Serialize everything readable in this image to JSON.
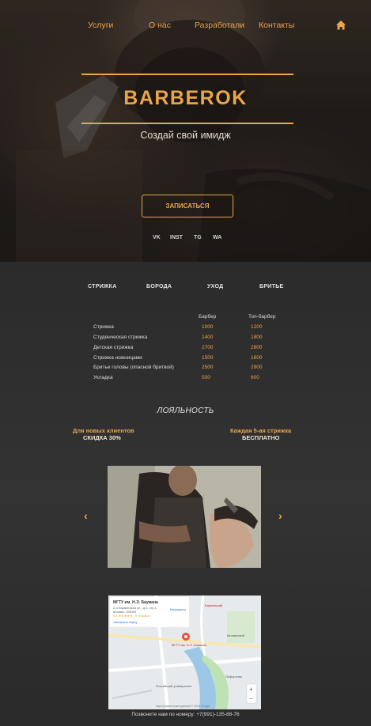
{
  "nav": {
    "items": [
      "Услуги",
      "О нас",
      "Разработали",
      "Контакты"
    ],
    "home_icon": "home-icon"
  },
  "hero": {
    "brand": "BARBEROK",
    "tagline": "Создай свой имидж",
    "cta_label": "ЗАПИСАТЬСЯ",
    "social": [
      "VK",
      "INST",
      "TG",
      "WA"
    ]
  },
  "services": {
    "tabs": [
      "СТРИЖКА",
      "БОРОДА",
      "УХОД",
      "БРИТЬЕ"
    ],
    "columns": [
      "Барбер",
      "Топ-барбер"
    ],
    "rows": [
      {
        "name": "Стрижка",
        "barber": "1000",
        "top": "1200"
      },
      {
        "name": "Студенческая стрижка",
        "barber": "1400",
        "top": "1800"
      },
      {
        "name": "Детская стрижка",
        "barber": "2700",
        "top": "2800"
      },
      {
        "name": "Стрижка ножницами",
        "barber": "1500",
        "top": "1600"
      },
      {
        "name": "Бритье головы (опасной бритвой)",
        "barber": "2500",
        "top": "2900"
      },
      {
        "name": "Укладка",
        "barber": "500",
        "top": "600"
      }
    ]
  },
  "loyalty": {
    "title": "ЛОЯЛЬНОСТЬ",
    "left_line1": "Для новых клиентов",
    "left_line2": "СКИДКА 30%",
    "right_line1": "Каждая 5-ая стрижка",
    "right_line2": "БЕСПЛАТНО"
  },
  "carousel": {
    "prev": "‹",
    "next": "›"
  },
  "map": {
    "card_title": "МГТУ им. Н.Э. Баумана",
    "card_addr": "2-я Бауманская ул., д.5, стр.1",
    "card_city": "Москва, 105005",
    "card_rating": "4,5 ★★★★★ · 9 отзывов",
    "card_link": "Увеличить карту",
    "route_label": "Маршруты",
    "label_1": "Бауманский",
    "label_2": "Москвоский",
    "label_3": "МГТУ им. Н.Э. Баумана",
    "label_4": "Лефортово",
    "label_5": "Российский университет",
    "footer_credit": "Картографические данные © 2023 Google"
  },
  "footer": {
    "text": "Позвоните нам по номеру: +7(991)-135-88-76"
  },
  "colors": {
    "accent": "#e9a54a",
    "background": "#2a2a2a"
  }
}
